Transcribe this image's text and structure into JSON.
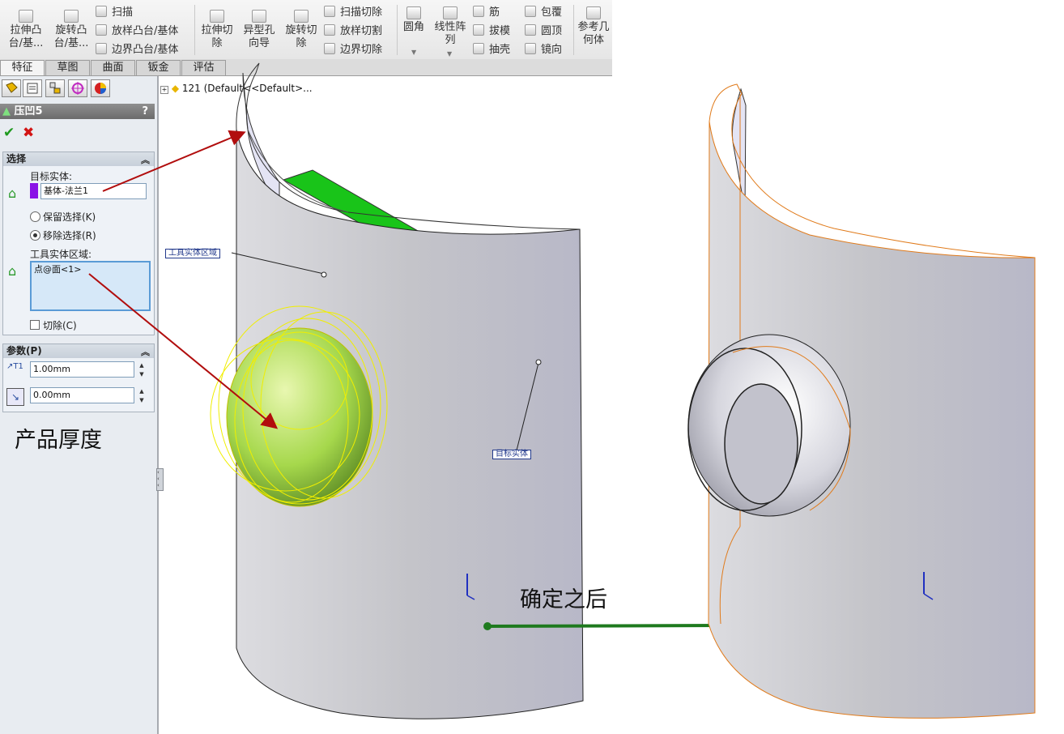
{
  "toolbar": {
    "extrude_boss": "拉伸凸\n台/基...",
    "revolve_boss": "旋转凸\n台/基...",
    "sweep": "扫描",
    "loft_boss": "放样凸台/基体",
    "boundary_boss": "边界凸台/基体",
    "extrude_cut": "拉伸切\n除",
    "hole_wizard": "异型孔\n向导",
    "revolve_cut": "旋转切\n除",
    "swept_cut": "扫描切除",
    "lofted_cut": "放样切割",
    "boundary_cut": "边界切除",
    "fillet": "圆角",
    "linear_pattern": "线性阵\n列",
    "rib": "筋",
    "draft": "拔模",
    "shell": "抽壳",
    "wrap": "包覆",
    "dome": "圆顶",
    "mirror": "镜向",
    "ref_geometry": "参考几\n何体"
  },
  "tabs": [
    "特征",
    "草图",
    "曲面",
    "钣金",
    "评估"
  ],
  "feature": {
    "title": "压凹5",
    "help": "?"
  },
  "selection": {
    "header": "选择",
    "target_label": "目标实体:",
    "target_value": "基体-法兰1",
    "keep_option": "保留选择(K)",
    "remove_option": "移除选择(R)",
    "tool_label": "工具实体区域:",
    "tool_value": "点@面<1>",
    "cut_option": "切除(C)",
    "target_color": "#8a12e6"
  },
  "parameters": {
    "header": "参数(P)",
    "thickness": "1.00mm",
    "clearance": "0.00mm"
  },
  "annotation_thickness": "产品厚度",
  "tree_root": "121 (Default<<Default>...",
  "callouts": {
    "tool_region": "工具实体区域",
    "target_body": "目标实体"
  },
  "after_label": "确定之后",
  "colors": {
    "arrow_red": "#b10d0d",
    "arrow_green": "#1e7a1e",
    "part_gray": "#c9c9cf",
    "tool_green": "#9ad24a",
    "edge_orange": "#e07a1a"
  }
}
